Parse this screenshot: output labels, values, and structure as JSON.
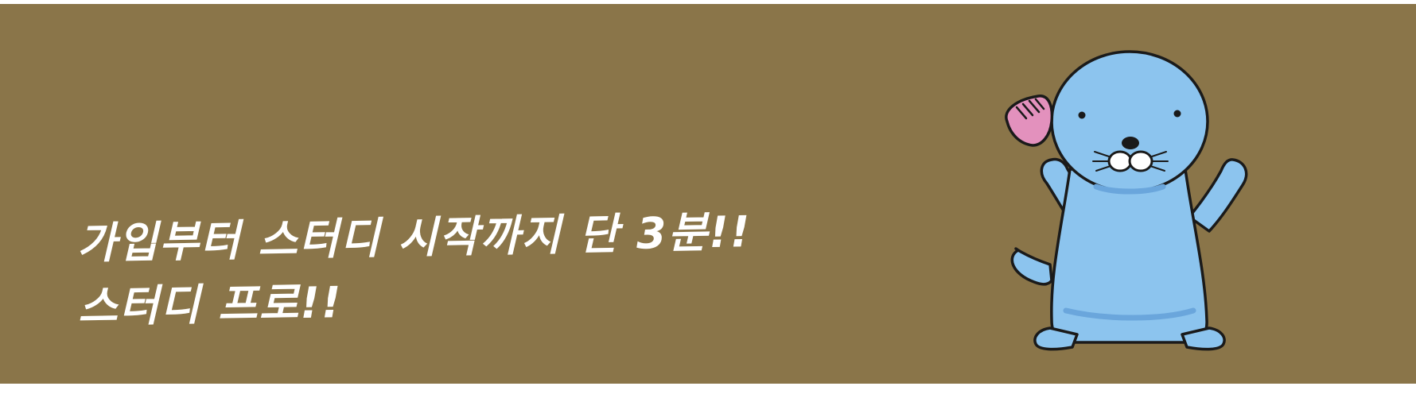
{
  "banner": {
    "background_color": "#8a7549",
    "headline_lines": [
      "가입부터 스터디 시작까지 단 3분!!",
      "스터디 프로!!"
    ],
    "mascot": {
      "icon": "blue-seal-mascot-icon",
      "body_color": "#8cc4ee",
      "shell_color": "#e391bd"
    }
  }
}
